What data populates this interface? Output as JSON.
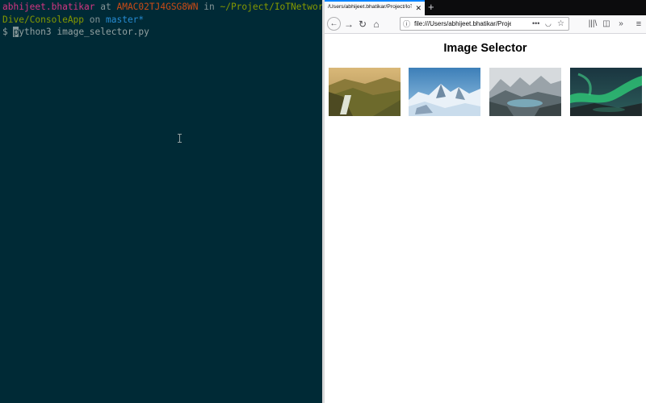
{
  "terminal": {
    "prompt": {
      "user": "abhijeet.bhatikar",
      "at": " at ",
      "host": "AMAC02TJ4GSG8WN",
      "in": " in ",
      "path_line1": "~/Project/IoTNetworkDeep",
      "path_line2": "Dive/ConsoleApp",
      "on": " on ",
      "branch": "master*"
    },
    "prompt_symbol": "$ ",
    "command_first_char": "p",
    "command_rest": "ython3 image_selector.py"
  },
  "browser": {
    "tab": {
      "title": "/Users/abhijeet.bhatikar/Project/IoT",
      "close_glyph": "✕"
    },
    "new_tab_glyph": "+",
    "nav": {
      "back_glyph": "←",
      "forward_glyph": "→",
      "reload_glyph": "↻",
      "home_glyph": "⌂",
      "library_glyph": "|||\\",
      "sidebar_glyph": "◫",
      "overflow_glyph": "»",
      "menu_glyph": "≡"
    },
    "url": {
      "info_glyph": "ⓘ",
      "value": "file:///Users/abhijeet.bhatikar/Project",
      "page_actions_glyph": "•••",
      "pocket_glyph": "◡",
      "bookmark_glyph": "☆"
    },
    "page": {
      "title": "Image Selector",
      "images": [
        {
          "subject": "golden mountain valley with waterfall"
        },
        {
          "subject": "snowy mountain peaks under blue sky"
        },
        {
          "subject": "mountain lake in misty valley"
        },
        {
          "subject": "green aurora over dark landscape"
        }
      ]
    }
  }
}
